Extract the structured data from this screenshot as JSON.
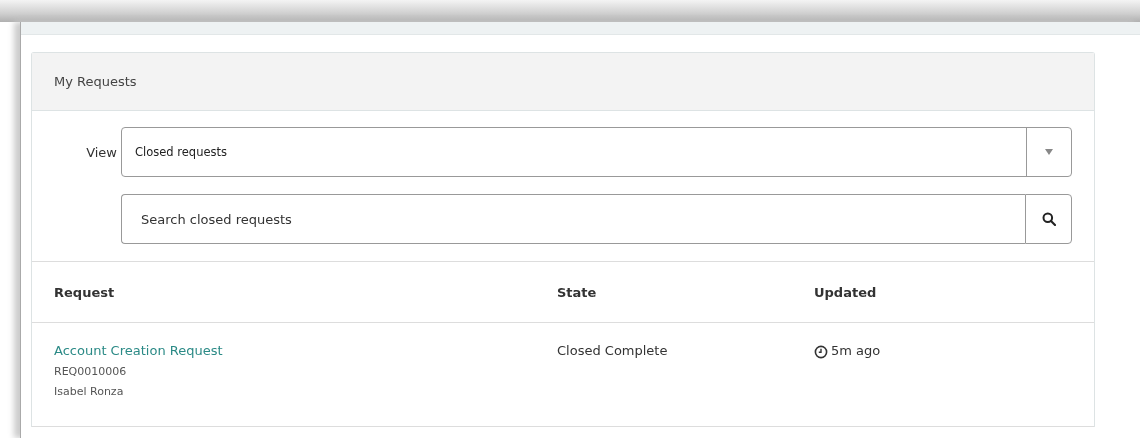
{
  "panel": {
    "title": "My Requests"
  },
  "view": {
    "label": "View",
    "value": "Closed requests"
  },
  "search": {
    "placeholder": "Search closed requests"
  },
  "table": {
    "columns": [
      "Request",
      "State",
      "Updated"
    ],
    "rows": [
      {
        "title": "Account Creation Request",
        "number": "REQ0010006",
        "requester": "Isabel Ronza",
        "state": "Closed Complete",
        "updated": "5m ago"
      }
    ]
  }
}
